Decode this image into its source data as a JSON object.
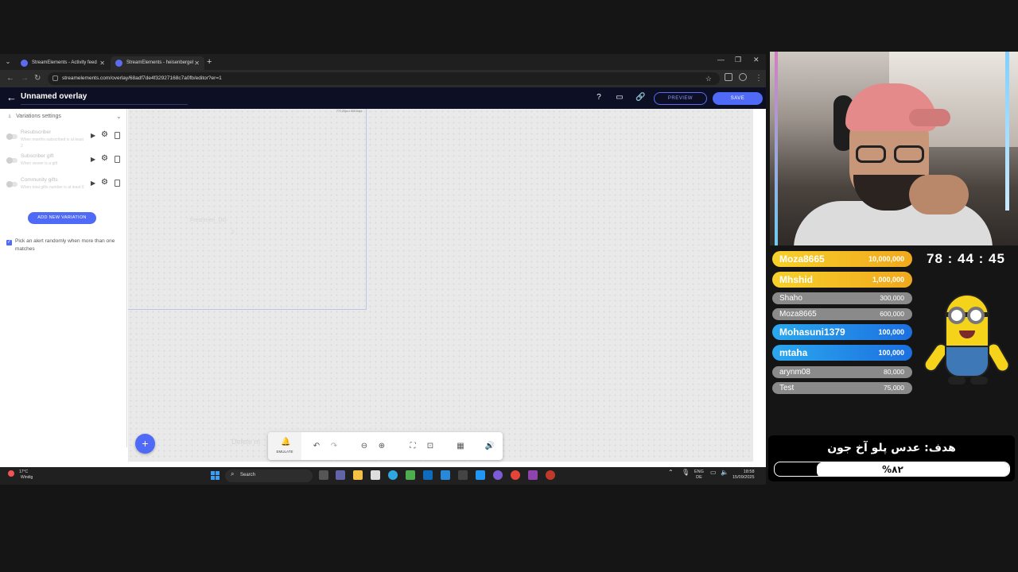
{
  "browser": {
    "tabs": [
      {
        "label": "StreamElements - Activity feed",
        "active": false
      },
      {
        "label": "StreamElements - heisenbergel",
        "active": true
      }
    ],
    "url": "streamelements.com/overlay/68adf7de4f32927168c7a0fb/editor?er=1"
  },
  "editor": {
    "title": "Unnamed overlay",
    "preview_label": "PREVIEW",
    "save_label": "SAVE",
    "panel_title": "Variations settings",
    "variations": [
      {
        "name": "Resubscriber",
        "desc": "When months subscribed is at least 2"
      },
      {
        "name": "Subscriber gift",
        "desc": "When viewer is a gift"
      },
      {
        "name": "Community gifts",
        "desc": "When total gifts number is at least 0"
      }
    ],
    "add_variation_label": "ADD NEW VARIATION",
    "random_pick_label": "Pick an alert randomly when more than one matches",
    "random_pick_checked": true,
    "canvas_size_label": "772.25px x 609.64px",
    "ghost_name": "Freshmen_DG",
    "ghost_sub": "2",
    "ghost_delete": "Delete m",
    "emulate_label": "EMULATE"
  },
  "taskbar": {
    "weather_temp": "17°C",
    "weather_desc": "Windig",
    "search_label": "Search",
    "lang_top": "ENG",
    "lang_bottom": "DE",
    "time": "18:58",
    "date": "15/09/2025"
  },
  "stream": {
    "leaderboard": [
      {
        "name": "Moza8665",
        "value": "10,000,000",
        "style": "gold"
      },
      {
        "name": "Mhshid",
        "value": "1,000,000",
        "style": "gold"
      },
      {
        "name": "Shaho",
        "value": "300,000",
        "style": "gray"
      },
      {
        "name": "Moza8665",
        "value": "600,000",
        "style": "gray"
      },
      {
        "name": "Mohasuni1379",
        "value": "100,000",
        "style": "blue"
      },
      {
        "name": "mtaha",
        "value": "100,000",
        "style": "blue"
      },
      {
        "name": "arynm08",
        "value": "80,000",
        "style": "gray"
      },
      {
        "name": "Test",
        "value": "75,000",
        "style": "gray"
      }
    ],
    "timer": "78 : 44 : 45",
    "goal_title": "هدف: عدس پلو آخ جون",
    "goal_percent_label": "%۸۲",
    "goal_progress": 0.82
  },
  "colors": {
    "accent": "#4f6af6",
    "gold_from": "#f7d02a",
    "gold_to": "#f0a81d",
    "blue_from": "#2aa8ee",
    "blue_to": "#1c6fe0",
    "gray": "#8a8a8a"
  }
}
